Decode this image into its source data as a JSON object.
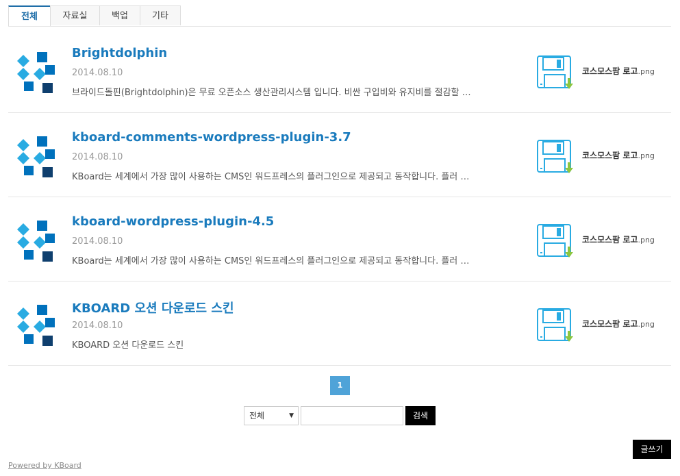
{
  "tabs": [
    {
      "label": "전체",
      "active": true
    },
    {
      "label": "자료실",
      "active": false
    },
    {
      "label": "백업",
      "active": false
    },
    {
      "label": "기타",
      "active": false
    }
  ],
  "items": [
    {
      "title": "Brightdolphin",
      "date": "2014.08.10",
      "description": "브라이드돌핀(Brightdolphin)은 무료 오픈소스 생산관리시스템 입니다. 비싼 구입비와 유지비를 절감할 …",
      "attachment": {
        "name": "코스모스팜 로고",
        "ext": ".png"
      }
    },
    {
      "title": "kboard-comments-wordpress-plugin-3.7",
      "date": "2014.08.10",
      "description": "KBoard는 세계에서 가장 많이 사용하는 CMS인 워드프레스의 플러그인으로 제공되고 동작합니다. 플러 …",
      "attachment": {
        "name": "코스모스팜 로고",
        "ext": ".png"
      }
    },
    {
      "title": "kboard-wordpress-plugin-4.5",
      "date": "2014.08.10",
      "description": "KBoard는 세계에서 가장 많이 사용하는 CMS인 워드프레스의 플러그인으로 제공되고 동작합니다. 플러 …",
      "attachment": {
        "name": "코스모스팜 로고",
        "ext": ".png"
      }
    },
    {
      "title": "KBOARD 오션 다운로드 스킨",
      "date": "2014.08.10",
      "description": "KBOARD 오션 다운로드 스킨",
      "attachment": {
        "name": "코스모스팜 로고",
        "ext": ".png"
      }
    }
  ],
  "pagination": {
    "current": "1"
  },
  "search": {
    "option": "전체",
    "button": "검색",
    "keyword": ""
  },
  "write_button": "글쓰기",
  "powered": "Powered by KBoard",
  "icons": {
    "thumbnail": "kboard-logo-icon",
    "attachment": "floppy-download-icon"
  },
  "colors": {
    "accent": "#1a7bbd",
    "page": "#4fa3d8",
    "logo_light": "#29abe2",
    "logo_mid": "#0071bc",
    "logo_dark": "#0f3f6e",
    "download": "#8dc63f"
  }
}
